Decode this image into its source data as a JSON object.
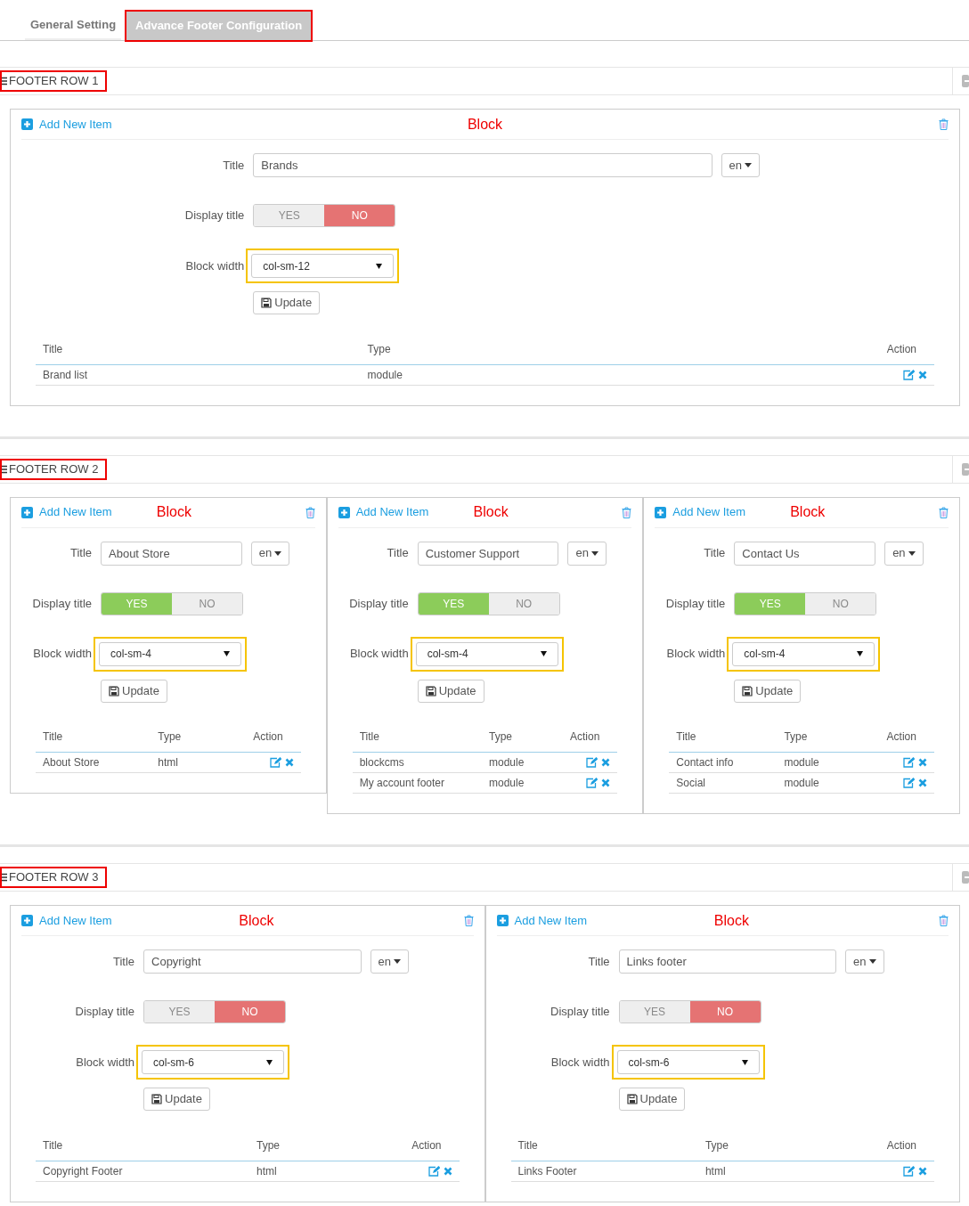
{
  "tabs": [
    {
      "label": "General Setting",
      "selected": false
    },
    {
      "label": "Advance Footer Configuration",
      "selected": true
    }
  ],
  "rows": [
    {
      "title": "FOOTER ROW 1",
      "blocks": [
        {
          "add_label": "Add New Item",
          "heading": "Block",
          "title_label": "Title",
          "title_value": "Brands",
          "lang": "en",
          "display_label": "Display title",
          "yes": "YES",
          "no": "NO",
          "display_title": false,
          "width_label": "Block width",
          "width_value": "col-sm-12",
          "update": "Update",
          "columns": [
            "Title",
            "Type",
            "Action"
          ],
          "items": [
            {
              "title": "Brand list",
              "type": "module"
            }
          ]
        }
      ]
    },
    {
      "title": "FOOTER ROW 2",
      "blocks": [
        {
          "add_label": "Add New Item",
          "heading": "Block",
          "title_label": "Title",
          "title_value": "About Store",
          "lang": "en",
          "display_label": "Display title",
          "yes": "YES",
          "no": "NO",
          "display_title": true,
          "width_label": "Block width",
          "width_value": "col-sm-4",
          "update": "Update",
          "columns": [
            "Title",
            "Type",
            "Action"
          ],
          "items": [
            {
              "title": "About Store",
              "type": "html"
            }
          ]
        },
        {
          "add_label": "Add New Item",
          "heading": "Block",
          "title_label": "Title",
          "title_value": "Customer Support",
          "lang": "en",
          "display_label": "Display title",
          "yes": "YES",
          "no": "NO",
          "display_title": true,
          "width_label": "Block width",
          "width_value": "col-sm-4",
          "update": "Update",
          "columns": [
            "Title",
            "Type",
            "Action"
          ],
          "items": [
            {
              "title": "blockcms",
              "type": "module"
            },
            {
              "title": "My account footer",
              "type": "module"
            }
          ]
        },
        {
          "add_label": "Add New Item",
          "heading": "Block",
          "title_label": "Title",
          "title_value": "Contact Us",
          "lang": "en",
          "display_label": "Display title",
          "yes": "YES",
          "no": "NO",
          "display_title": true,
          "width_label": "Block width",
          "width_value": "col-sm-4",
          "update": "Update",
          "columns": [
            "Title",
            "Type",
            "Action"
          ],
          "items": [
            {
              "title": "Contact info",
              "type": "module"
            },
            {
              "title": "Social",
              "type": "module"
            }
          ]
        }
      ]
    },
    {
      "title": "FOOTER ROW 3",
      "blocks": [
        {
          "add_label": "Add New Item",
          "heading": "Block",
          "title_label": "Title",
          "title_value": "Copyright",
          "lang": "en",
          "display_label": "Display title",
          "yes": "YES",
          "no": "NO",
          "display_title": false,
          "width_label": "Block width",
          "width_value": "col-sm-6",
          "update": "Update",
          "columns": [
            "Title",
            "Type",
            "Action"
          ],
          "items": [
            {
              "title": "Copyright Footer",
              "type": "html"
            }
          ]
        },
        {
          "add_label": "Add New Item",
          "heading": "Block",
          "title_label": "Title",
          "title_value": "Links footer",
          "lang": "en",
          "display_label": "Display title",
          "yes": "YES",
          "no": "NO",
          "display_title": false,
          "width_label": "Block width",
          "width_value": "col-sm-6",
          "update": "Update",
          "columns": [
            "Title",
            "Type",
            "Action"
          ],
          "items": [
            {
              "title": "Links Footer",
              "type": "html"
            }
          ]
        }
      ]
    }
  ]
}
